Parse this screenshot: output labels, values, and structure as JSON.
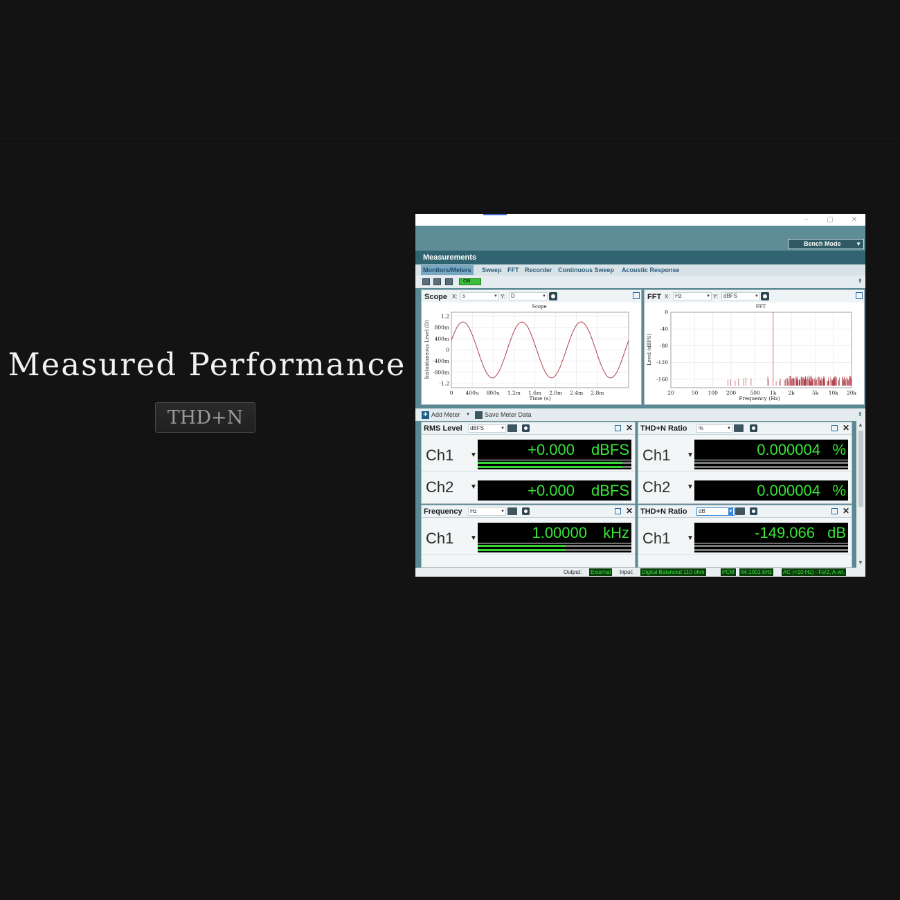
{
  "headline": "Measured Performance",
  "badge": "THD+N",
  "app": {
    "window_controls": [
      "–",
      "▢",
      "✕"
    ],
    "mode_select": "Bench Mode",
    "section_title": "Measurements",
    "tabs": [
      "Monitors/Meters",
      "Sweep",
      "FFT",
      "Recorder",
      "Continuous Sweep",
      "Acoustic Response"
    ],
    "active_tab": "Monitors/Meters",
    "generator_toggle": "ON",
    "scope": {
      "name": "Scope",
      "x_label": "X:",
      "x_unit": "s",
      "y_label": "Y:",
      "y_unit": "D"
    },
    "fft": {
      "name": "FFT",
      "x_label": "X:",
      "x_unit": "Hz",
      "y_label": "Y:",
      "y_unit": "dBFS"
    },
    "meter_toolbar": {
      "add": "Add Meter",
      "save": "Save Meter Data"
    },
    "meters": {
      "rms": {
        "name": "RMS Level",
        "unit_select": "dBFS",
        "ch1_label": "Ch1",
        "ch2_label": "Ch2",
        "ch1_value": "+0.000",
        "ch2_value": "+0.000",
        "unit": "dBFS",
        "ch1_bar_fraction": 0.94,
        "ch2_bar_fraction": 0.94
      },
      "thdn_pct": {
        "name": "THD+N Ratio",
        "unit_select": "%",
        "ch1_label": "Ch1",
        "ch2_label": "Ch2",
        "ch1_value": "0.000004",
        "ch2_value": "0.000004",
        "unit": "%",
        "ch1_bar_fraction": 0.0,
        "ch2_bar_fraction": 0.0
      },
      "freq": {
        "name": "Frequency",
        "unit_select": "Hz",
        "ch1_label": "Ch1",
        "ch1_value": "1.00000",
        "unit": "kHz",
        "ch1_bar_fraction": 0.57
      },
      "thdn_db": {
        "name": "THD+N Ratio",
        "unit_select": "dB",
        "ch1_label": "Ch1",
        "ch1_value": "-149.066",
        "unit": "dB",
        "ch1_bar_fraction": 0.0
      }
    },
    "status": {
      "output_label": "Output:",
      "output": "External",
      "input_label": "Input:",
      "input": "Digital Balanced 110 ohm",
      "format": "PCM",
      "rate": "44.1001 kHz",
      "filter": "AC (<10 Hz) - Fs/2, A-wt."
    }
  },
  "chart_data": [
    {
      "type": "line",
      "title": "Scope",
      "xlabel": "Time (s)",
      "ylabel": "Instantaneous Level (D)",
      "x_ticks": [
        "0",
        "400u",
        "800u",
        "1.2m",
        "1.6m",
        "2.0m",
        "2.4m",
        "2.8m"
      ],
      "y_ticks": [
        "1.2",
        "800m",
        "400m",
        "0",
        "-400m",
        "-800m",
        "-1.2"
      ],
      "xlim": [
        0,
        0.003
      ],
      "ylim": [
        -1.2,
        1.2
      ],
      "series": [
        {
          "frequency_hz": 1000,
          "amplitude": 1.0,
          "color": "#b0404a"
        }
      ],
      "grid": true
    },
    {
      "type": "line",
      "title": "FFT",
      "xlabel": "Frequency (Hz)",
      "ylabel": "Level (dBFS)",
      "x_scale": "log",
      "x_ticks": [
        "20",
        "50",
        "100",
        "200",
        "500",
        "1k",
        "2k",
        "5k",
        "10k",
        "20k"
      ],
      "y_ticks": [
        "0",
        "-40",
        "-80",
        "-120",
        "-160"
      ],
      "xlim": [
        20,
        20000
      ],
      "ylim": [
        -180,
        0
      ],
      "fundamental_hz": 1000,
      "fundamental_db": 0,
      "noise_floor_db": -165,
      "color": "#b0404a",
      "grid": true
    }
  ]
}
